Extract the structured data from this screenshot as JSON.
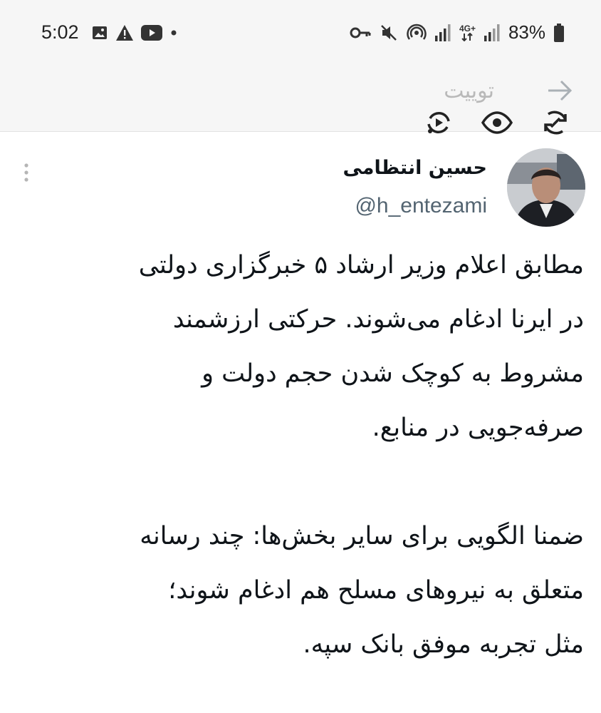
{
  "status_bar": {
    "time": "5:02",
    "left_icons": [
      "image-icon",
      "warning-icon",
      "youtube-icon",
      "dot-icon"
    ],
    "right_icons": [
      "key-icon",
      "mute-icon",
      "hotspot-icon",
      "signal-icon",
      "network-4g-icon",
      "signal-icon"
    ],
    "network_label": "4G+",
    "battery_text": "83%"
  },
  "header": {
    "title": "توییت",
    "actions": [
      "back-arrow-icon",
      "retweet-icon",
      "eye-icon",
      "sync-icon"
    ]
  },
  "tweet": {
    "author_name": "حسین انتظامی",
    "author_handle": "@h_entezami",
    "paragraphs": [
      [
        "مطابق اعلام وزیر ارشاد ۵ خبرگزاری دولتی",
        "در ایرنا ادغام می‌شوند. حرکتی ارزشمند",
        "مشروط به کوچک شدن حجم دولت و",
        "صرفه‌جویی در منابع."
      ],
      [
        "ضمنا الگویی برای سایر بخش‌ها: چند رسانه",
        "متعلق به نیروهای مسلح هم ادغام شوند؛",
        "مثل تجربه موفق بانک سپه."
      ]
    ]
  },
  "colors": {
    "link": "#1d9bf0",
    "muted": "#536471",
    "header_bg": "#f6f6f6"
  }
}
